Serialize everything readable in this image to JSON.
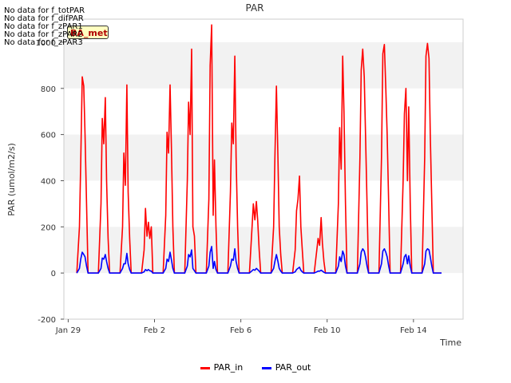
{
  "page": {
    "nodata_lines": [
      "No data for f_totPAR",
      "No data for f_difPAR",
      "No data for f_zPAR1",
      "No data for f_zPAR2",
      "No data for f_zPAR3"
    ],
    "badge_text": "BA_met"
  },
  "chart_data": {
    "type": "line",
    "title": "PAR",
    "xlabel": "Time",
    "ylabel": "PAR (umol/m2/s)",
    "ylim": [
      -200,
      1100
    ],
    "yticks": [
      -200,
      0,
      200,
      400,
      600,
      800,
      1000
    ],
    "xlim": [
      -0.2,
      18.3
    ],
    "xticks": [
      {
        "x": 0,
        "label": "Jan 29"
      },
      {
        "x": 4,
        "label": "Feb 2"
      },
      {
        "x": 8,
        "label": "Feb 6"
      },
      {
        "x": 12,
        "label": "Feb 10"
      },
      {
        "x": 16,
        "label": "Feb 14"
      }
    ],
    "grid": "alternating bands",
    "legend": "bottom-center",
    "series": [
      {
        "name": "PAR_in",
        "color": "#ff0000",
        "points": [
          [
            0.4,
            0
          ],
          [
            0.52,
            200
          ],
          [
            0.58,
            480
          ],
          [
            0.65,
            850
          ],
          [
            0.72,
            810
          ],
          [
            0.78,
            600
          ],
          [
            0.85,
            300
          ],
          [
            0.92,
            0
          ],
          [
            1.4,
            0
          ],
          [
            1.52,
            300
          ],
          [
            1.58,
            670
          ],
          [
            1.65,
            560
          ],
          [
            1.72,
            760
          ],
          [
            1.78,
            400
          ],
          [
            1.85,
            150
          ],
          [
            1.92,
            0
          ],
          [
            2.4,
            0
          ],
          [
            2.52,
            200
          ],
          [
            2.58,
            520
          ],
          [
            2.65,
            380
          ],
          [
            2.72,
            815
          ],
          [
            2.78,
            350
          ],
          [
            2.85,
            150
          ],
          [
            2.92,
            0
          ],
          [
            3.4,
            0
          ],
          [
            3.52,
            100
          ],
          [
            3.58,
            280
          ],
          [
            3.65,
            160
          ],
          [
            3.72,
            220
          ],
          [
            3.78,
            150
          ],
          [
            3.85,
            200
          ],
          [
            3.92,
            0
          ],
          [
            4.4,
            0
          ],
          [
            4.52,
            250
          ],
          [
            4.58,
            610
          ],
          [
            4.65,
            520
          ],
          [
            4.72,
            815
          ],
          [
            4.78,
            560
          ],
          [
            4.85,
            200
          ],
          [
            4.92,
            0
          ],
          [
            5.4,
            0
          ],
          [
            5.52,
            400
          ],
          [
            5.58,
            740
          ],
          [
            5.65,
            600
          ],
          [
            5.72,
            970
          ],
          [
            5.78,
            200
          ],
          [
            5.85,
            160
          ],
          [
            5.92,
            0
          ],
          [
            6.4,
            0
          ],
          [
            6.52,
            320
          ],
          [
            6.58,
            900
          ],
          [
            6.65,
            1075
          ],
          [
            6.72,
            250
          ],
          [
            6.78,
            490
          ],
          [
            6.85,
            200
          ],
          [
            6.92,
            0
          ],
          [
            7.4,
            0
          ],
          [
            7.52,
            350
          ],
          [
            7.58,
            650
          ],
          [
            7.65,
            560
          ],
          [
            7.72,
            940
          ],
          [
            7.78,
            500
          ],
          [
            7.85,
            200
          ],
          [
            7.92,
            0
          ],
          [
            8.4,
            0
          ],
          [
            8.52,
            200
          ],
          [
            8.58,
            300
          ],
          [
            8.65,
            230
          ],
          [
            8.72,
            310
          ],
          [
            8.78,
            230
          ],
          [
            8.85,
            100
          ],
          [
            8.92,
            0
          ],
          [
            9.4,
            0
          ],
          [
            9.52,
            200
          ],
          [
            9.58,
            500
          ],
          [
            9.65,
            810
          ],
          [
            9.72,
            500
          ],
          [
            9.78,
            200
          ],
          [
            9.85,
            80
          ],
          [
            9.92,
            0
          ],
          [
            10.4,
            0
          ],
          [
            10.52,
            100
          ],
          [
            10.58,
            270
          ],
          [
            10.65,
            320
          ],
          [
            10.72,
            420
          ],
          [
            10.78,
            200
          ],
          [
            10.85,
            100
          ],
          [
            10.92,
            0
          ],
          [
            11.4,
            0
          ],
          [
            11.52,
            100
          ],
          [
            11.58,
            150
          ],
          [
            11.65,
            120
          ],
          [
            11.72,
            240
          ],
          [
            11.78,
            130
          ],
          [
            11.85,
            50
          ],
          [
            11.92,
            0
          ],
          [
            12.4,
            0
          ],
          [
            12.52,
            300
          ],
          [
            12.58,
            630
          ],
          [
            12.65,
            450
          ],
          [
            12.72,
            940
          ],
          [
            12.78,
            700
          ],
          [
            12.85,
            300
          ],
          [
            12.92,
            0
          ],
          [
            13.4,
            0
          ],
          [
            13.52,
            500
          ],
          [
            13.58,
            880
          ],
          [
            13.65,
            970
          ],
          [
            13.72,
            850
          ],
          [
            13.78,
            600
          ],
          [
            13.85,
            300
          ],
          [
            13.92,
            0
          ],
          [
            14.4,
            0
          ],
          [
            14.52,
            500
          ],
          [
            14.58,
            950
          ],
          [
            14.65,
            990
          ],
          [
            14.72,
            800
          ],
          [
            14.78,
            600
          ],
          [
            14.85,
            300
          ],
          [
            14.92,
            0
          ],
          [
            15.4,
            0
          ],
          [
            15.52,
            400
          ],
          [
            15.58,
            690
          ],
          [
            15.65,
            800
          ],
          [
            15.72,
            400
          ],
          [
            15.78,
            720
          ],
          [
            15.85,
            300
          ],
          [
            15.92,
            0
          ],
          [
            16.4,
            0
          ],
          [
            16.52,
            500
          ],
          [
            16.58,
            940
          ],
          [
            16.65,
            995
          ],
          [
            16.72,
            930
          ],
          [
            16.78,
            600
          ],
          [
            16.85,
            300
          ],
          [
            16.92,
            0
          ]
        ]
      },
      {
        "name": "PAR_out",
        "color": "#0000ff",
        "points": [
          [
            0.4,
            0
          ],
          [
            0.52,
            20
          ],
          [
            0.58,
            60
          ],
          [
            0.65,
            90
          ],
          [
            0.72,
            80
          ],
          [
            0.78,
            70
          ],
          [
            0.85,
            30
          ],
          [
            0.92,
            0
          ],
          [
            1.4,
            0
          ],
          [
            1.52,
            20
          ],
          [
            1.58,
            65
          ],
          [
            1.65,
            60
          ],
          [
            1.72,
            80
          ],
          [
            1.78,
            50
          ],
          [
            1.85,
            20
          ],
          [
            1.92,
            0
          ],
          [
            2.4,
            0
          ],
          [
            2.52,
            20
          ],
          [
            2.58,
            40
          ],
          [
            2.65,
            40
          ],
          [
            2.72,
            85
          ],
          [
            2.78,
            40
          ],
          [
            2.85,
            15
          ],
          [
            2.92,
            0
          ],
          [
            3.4,
            0
          ],
          [
            3.52,
            5
          ],
          [
            3.58,
            15
          ],
          [
            3.65,
            10
          ],
          [
            3.72,
            15
          ],
          [
            3.78,
            10
          ],
          [
            3.85,
            8
          ],
          [
            3.92,
            0
          ],
          [
            4.4,
            0
          ],
          [
            4.52,
            20
          ],
          [
            4.58,
            60
          ],
          [
            4.65,
            50
          ],
          [
            4.72,
            90
          ],
          [
            4.78,
            60
          ],
          [
            4.85,
            20
          ],
          [
            4.92,
            0
          ],
          [
            5.4,
            0
          ],
          [
            5.52,
            30
          ],
          [
            5.58,
            80
          ],
          [
            5.65,
            70
          ],
          [
            5.72,
            100
          ],
          [
            5.78,
            20
          ],
          [
            5.85,
            10
          ],
          [
            5.92,
            0
          ],
          [
            6.4,
            0
          ],
          [
            6.52,
            30
          ],
          [
            6.58,
            90
          ],
          [
            6.65,
            115
          ],
          [
            6.72,
            20
          ],
          [
            6.78,
            50
          ],
          [
            6.85,
            15
          ],
          [
            6.92,
            0
          ],
          [
            7.4,
            0
          ],
          [
            7.52,
            30
          ],
          [
            7.58,
            60
          ],
          [
            7.65,
            55
          ],
          [
            7.72,
            105
          ],
          [
            7.78,
            50
          ],
          [
            7.85,
            20
          ],
          [
            7.92,
            0
          ],
          [
            8.4,
            0
          ],
          [
            8.52,
            10
          ],
          [
            8.58,
            15
          ],
          [
            8.65,
            12
          ],
          [
            8.72,
            20
          ],
          [
            8.78,
            15
          ],
          [
            8.85,
            8
          ],
          [
            8.92,
            0
          ],
          [
            9.4,
            0
          ],
          [
            9.52,
            20
          ],
          [
            9.58,
            50
          ],
          [
            9.65,
            80
          ],
          [
            9.72,
            50
          ],
          [
            9.78,
            20
          ],
          [
            9.85,
            8
          ],
          [
            9.92,
            0
          ],
          [
            10.4,
            0
          ],
          [
            10.52,
            5
          ],
          [
            10.58,
            15
          ],
          [
            10.65,
            20
          ],
          [
            10.72,
            25
          ],
          [
            10.78,
            12
          ],
          [
            10.85,
            5
          ],
          [
            10.92,
            0
          ],
          [
            11.4,
            0
          ],
          [
            11.52,
            5
          ],
          [
            11.58,
            8
          ],
          [
            11.65,
            8
          ],
          [
            11.72,
            12
          ],
          [
            11.78,
            8
          ],
          [
            11.85,
            3
          ],
          [
            11.92,
            0
          ],
          [
            12.4,
            0
          ],
          [
            12.52,
            30
          ],
          [
            12.58,
            70
          ],
          [
            12.65,
            50
          ],
          [
            12.72,
            95
          ],
          [
            12.78,
            80
          ],
          [
            12.85,
            30
          ],
          [
            12.92,
            0
          ],
          [
            13.4,
            0
          ],
          [
            13.52,
            40
          ],
          [
            13.58,
            90
          ],
          [
            13.65,
            105
          ],
          [
            13.72,
            95
          ],
          [
            13.78,
            70
          ],
          [
            13.85,
            30
          ],
          [
            13.92,
            0
          ],
          [
            14.4,
            0
          ],
          [
            14.52,
            40
          ],
          [
            14.58,
            95
          ],
          [
            14.65,
            105
          ],
          [
            14.72,
            90
          ],
          [
            14.78,
            70
          ],
          [
            14.85,
            30
          ],
          [
            14.92,
            0
          ],
          [
            15.4,
            0
          ],
          [
            15.52,
            40
          ],
          [
            15.58,
            70
          ],
          [
            15.65,
            80
          ],
          [
            15.72,
            40
          ],
          [
            15.78,
            75
          ],
          [
            15.85,
            30
          ],
          [
            15.92,
            0
          ],
          [
            16.4,
            0
          ],
          [
            16.52,
            40
          ],
          [
            16.58,
            95
          ],
          [
            16.65,
            105
          ],
          [
            16.72,
            100
          ],
          [
            16.78,
            70
          ],
          [
            16.85,
            30
          ],
          [
            16.92,
            0
          ]
        ]
      }
    ]
  }
}
